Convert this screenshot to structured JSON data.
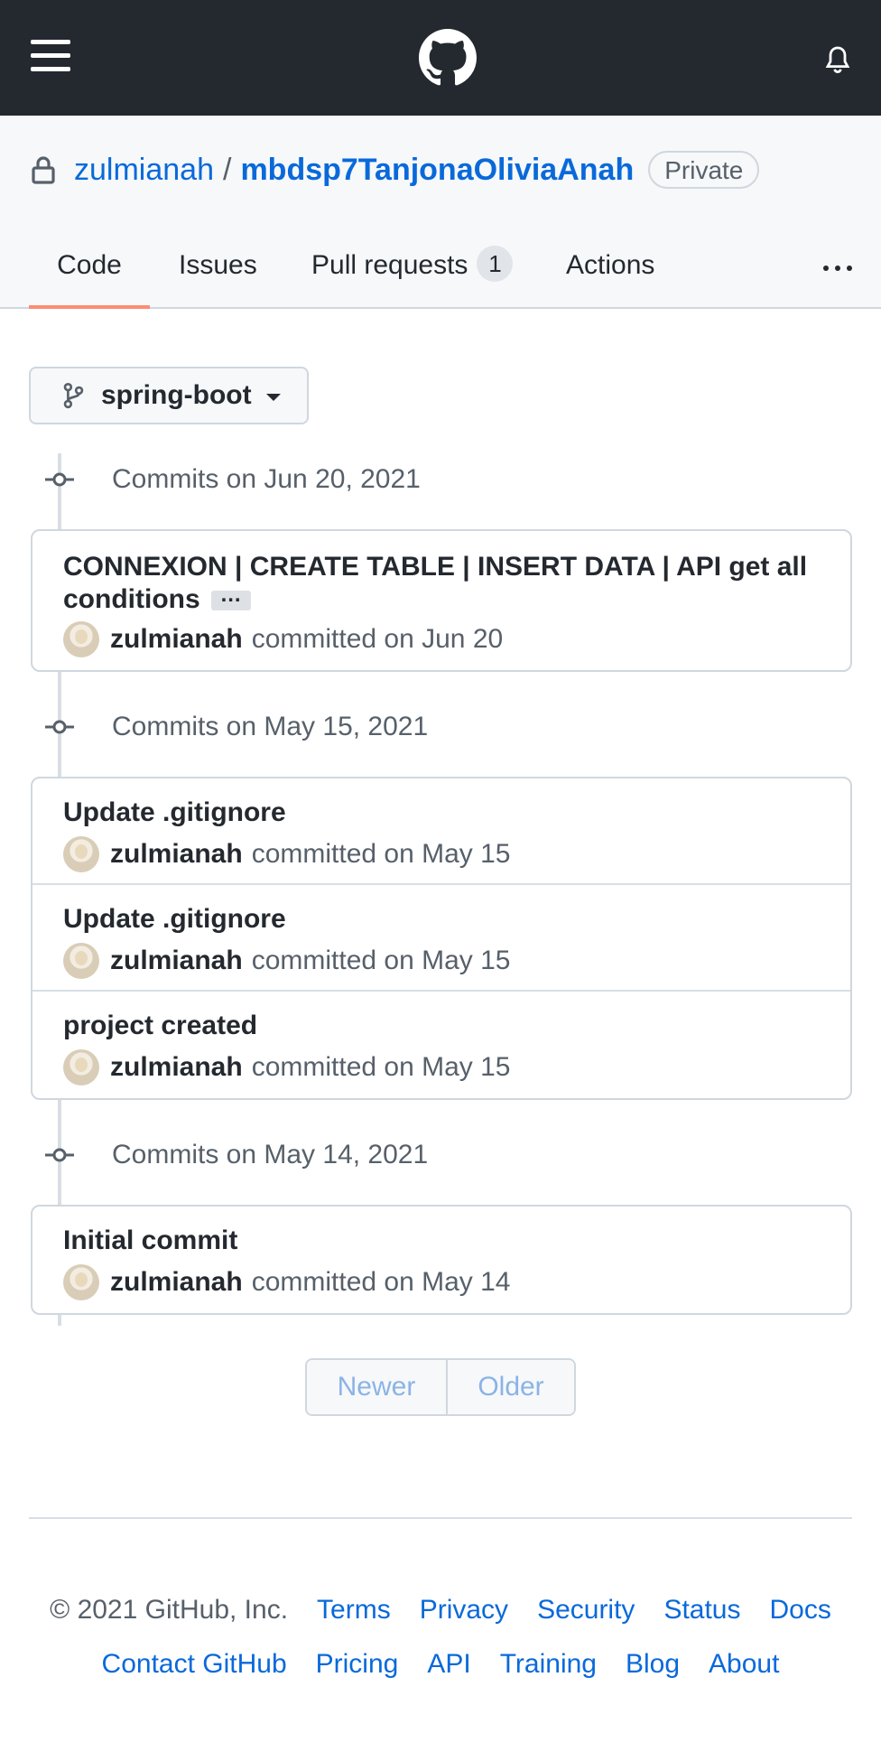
{
  "header": {
    "menu_icon": "hamburger-icon",
    "logo_icon": "github-mark-icon",
    "notification_icon": "bell-icon"
  },
  "repo": {
    "owner": "zulmianah",
    "separator": "/",
    "name": "mbdsp7TanjonaOliviaAnah",
    "visibility": "Private"
  },
  "tabs": [
    {
      "label": "Code",
      "selected": true
    },
    {
      "label": "Issues"
    },
    {
      "label": "Pull requests",
      "count": "1"
    },
    {
      "label": "Actions"
    }
  ],
  "branch": {
    "label": "spring-boot"
  },
  "groups": [
    {
      "heading": "Commits on Jun 20, 2021",
      "commits": [
        {
          "title_line1": "CONNEXION | CREATE TABLE | INSERT DATA | API get all",
          "title_line2": "conditions",
          "expander": "…",
          "author": "zulmianah",
          "meta": "committed on Jun 20"
        }
      ]
    },
    {
      "heading": "Commits on May 15, 2021",
      "commits": [
        {
          "title": "Update .gitignore",
          "author": "zulmianah",
          "meta": "committed on May 15"
        },
        {
          "title": "Update .gitignore",
          "author": "zulmianah",
          "meta": "committed on May 15"
        },
        {
          "title": "project created",
          "author": "zulmianah",
          "meta": "committed on May 15"
        }
      ]
    },
    {
      "heading": "Commits on May 14, 2021",
      "commits": [
        {
          "title": "Initial commit",
          "author": "zulmianah",
          "meta": "committed on May 14"
        }
      ]
    }
  ],
  "pagination": {
    "newer": "Newer",
    "older": "Older"
  },
  "footer": {
    "copyright": "© 2021 GitHub, Inc.",
    "row1": [
      "Terms",
      "Privacy",
      "Security",
      "Status",
      "Docs"
    ],
    "row2": [
      "Contact GitHub",
      "Pricing",
      "API",
      "Training",
      "Blog",
      "About"
    ]
  },
  "colors": {
    "header_bg": "#24292f",
    "link": "#0969da",
    "tab_underline": "#fd8c73"
  }
}
